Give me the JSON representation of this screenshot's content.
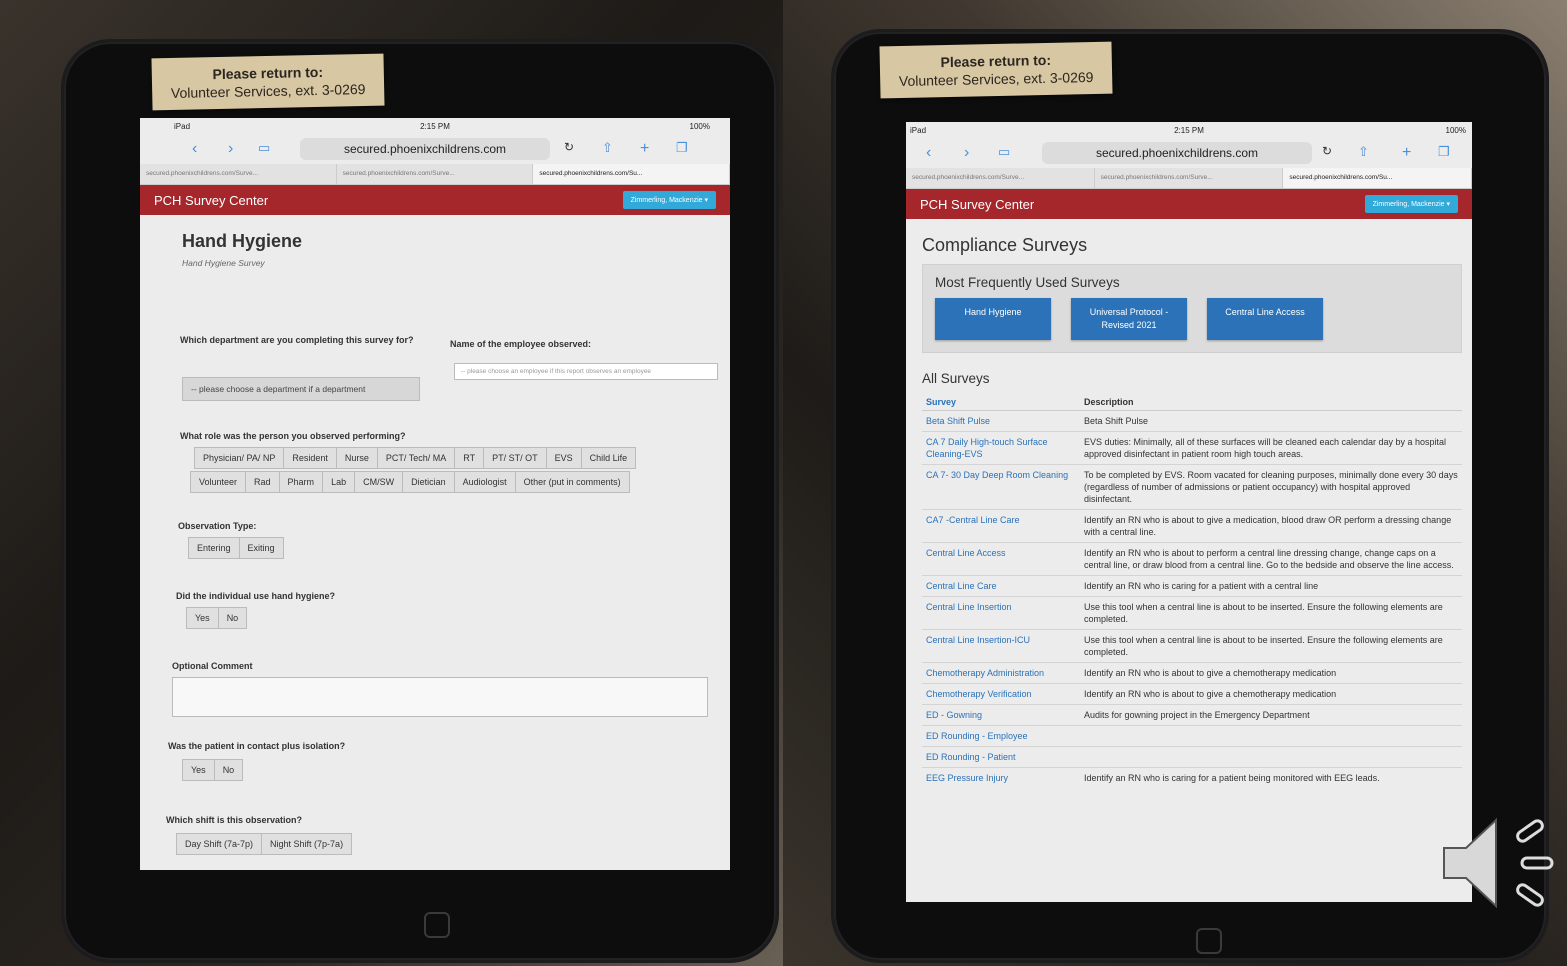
{
  "sticky_note": {
    "line1": "Please return to:",
    "line2": "Volunteer Services, ext. 3-0269"
  },
  "status_bar": {
    "device": "iPad",
    "time": "2:15 PM",
    "battery": "100%"
  },
  "browser": {
    "url": "secured.phoenixchildrens.com",
    "tabs_left": [
      "secured.phoenixchildrens.com/Surve...",
      "secured.phoenixchildrens.com/Surve...",
      "secured.phoenixchildrens.com/Su..."
    ],
    "tabs_right": [
      "secured.phoenixchildrens.com/Surve...",
      "secured.phoenixchildrens.com/Surve...",
      "secured.phoenixchildrens.com/Su..."
    ]
  },
  "navbar": {
    "brand": "PCH Survey Center",
    "user": "Zimmerling, Mackenzie ▾"
  },
  "survey": {
    "title": "Hand Hygiene",
    "subtitle": "Hand Hygiene Survey",
    "q_department": "Which department are you completing this survey for?",
    "department_placeholder": "-- please choose a department if a department",
    "q_employee": "Name of the employee observed:",
    "employee_placeholder": "-- please choose an employee if this report observes an employee",
    "q_role": "What role was the person you observed performing?",
    "roles_row1": [
      "Physician/ PA/ NP",
      "Resident",
      "Nurse",
      "PCT/ Tech/ MA",
      "RT",
      "PT/ ST/ OT",
      "EVS",
      "Child Life"
    ],
    "roles_row2": [
      "Volunteer",
      "Rad",
      "Pharm",
      "Lab",
      "CM/SW",
      "Dietician",
      "Audiologist",
      "Other (put in comments)"
    ],
    "q_observation": "Observation Type:",
    "observation_options": [
      "Entering",
      "Exiting"
    ],
    "q_hygiene": "Did the individual use hand hygiene?",
    "hygiene_options": [
      "Yes",
      "No"
    ],
    "q_comment": "Optional Comment",
    "q_isolation": "Was the patient in contact plus isolation?",
    "isolation_options": [
      "Yes",
      "No"
    ],
    "q_shift": "Which shift is this observation?",
    "shift_options": [
      "Day Shift (7a-7p)",
      "Night Shift (7p-7a)"
    ]
  },
  "compliance": {
    "title": "Compliance Surveys",
    "frequent_title": "Most Frequently Used Surveys",
    "frequent_buttons": [
      "Hand Hygiene",
      "Universal Protocol - Revised 2021",
      "Central Line Access"
    ],
    "all_title": "All Surveys",
    "col_survey": "Survey",
    "col_description": "Description",
    "rows": [
      {
        "name": "Beta Shift Pulse",
        "desc": "Beta Shift Pulse"
      },
      {
        "name": "CA 7 Daily High-touch Surface Cleaning-EVS",
        "desc": "EVS duties: Minimally, all of these surfaces will be cleaned each calendar day by a hospital approved disinfectant in patient room high touch areas."
      },
      {
        "name": "CA 7- 30 Day Deep Room Cleaning",
        "desc": "To be completed by EVS. Room vacated for cleaning purposes, minimally done every 30 days (regardless of number of admissions or patient occupancy) with hospital approved disinfectant."
      },
      {
        "name": "CA7 -Central Line Care",
        "desc": "Identify an RN who is about to give a medication, blood draw OR perform a dressing change with a central line."
      },
      {
        "name": "Central Line Access",
        "desc": "Identify an RN who is about to perform a central line dressing change, change caps on a central line, or draw blood from a central line. Go to the bedside and observe the line access."
      },
      {
        "name": "Central Line Care",
        "desc": "Identify an RN who is caring for a patient with a central line"
      },
      {
        "name": "Central Line Insertion",
        "desc": "Use this tool when a central line is about to be inserted. Ensure the following elements are completed."
      },
      {
        "name": "Central Line Insertion-ICU",
        "desc": "Use this tool when a central line is about to be inserted. Ensure the following elements are completed."
      },
      {
        "name": "Chemotherapy Administration",
        "desc": "Identify an RN who is about to give a chemotherapy medication"
      },
      {
        "name": "Chemotherapy Verification",
        "desc": "Identify an RN who is about to give a chemotherapy medication"
      },
      {
        "name": "ED - Gowning",
        "desc": "Audits for gowning project in the Emergency Department"
      },
      {
        "name": "ED Rounding - Employee",
        "desc": ""
      },
      {
        "name": "ED Rounding - Patient",
        "desc": ""
      },
      {
        "name": "EEG Pressure Injury",
        "desc": "Identify an RN who is caring for a patient being monitored with EEG leads."
      }
    ]
  },
  "icons": {
    "back": "chevron-left-icon",
    "forward": "chevron-right-icon",
    "bookmarks": "book-icon",
    "reload": "reload-icon",
    "share": "share-icon",
    "new_tab": "plus-icon",
    "tabs": "tabs-icon",
    "speaker": "speaker-icon"
  },
  "colors": {
    "navbar": "#a5262b",
    "primary_button": "#2b72b8",
    "user_badge": "#31a9d9"
  }
}
